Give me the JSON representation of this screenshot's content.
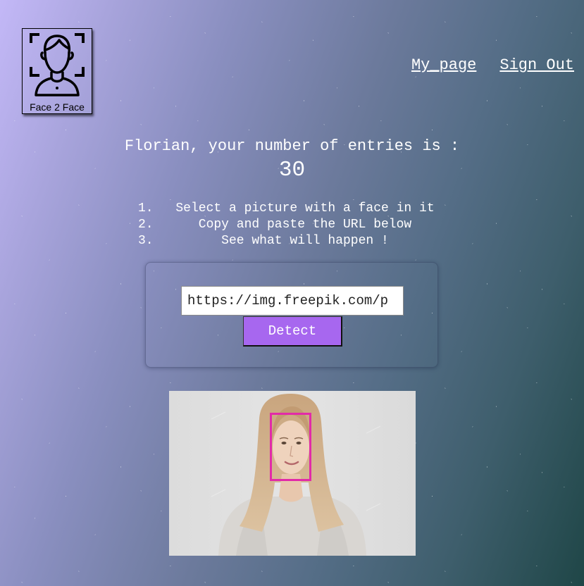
{
  "app": {
    "logo_text": "Face 2 Face",
    "logo_icon": "face-scan-icon"
  },
  "nav": {
    "my_page": "My_page",
    "sign_out": "Sign Out"
  },
  "greeting": {
    "text": "Florian, your number of entries is :",
    "entries": "30"
  },
  "steps": [
    {
      "num": "1.",
      "text": "Select a picture with a face in it"
    },
    {
      "num": "2.",
      "text": "Copy and paste the URL below"
    },
    {
      "num": "3.",
      "text": "See what will happen !"
    }
  ],
  "form": {
    "url_value": "https://img.freepik.com/p",
    "detect_label": "Detect"
  },
  "result": {
    "face_box_color": "#e22ba8"
  },
  "colors": {
    "accent": "#a767ef",
    "face_box": "#e22ba8"
  }
}
